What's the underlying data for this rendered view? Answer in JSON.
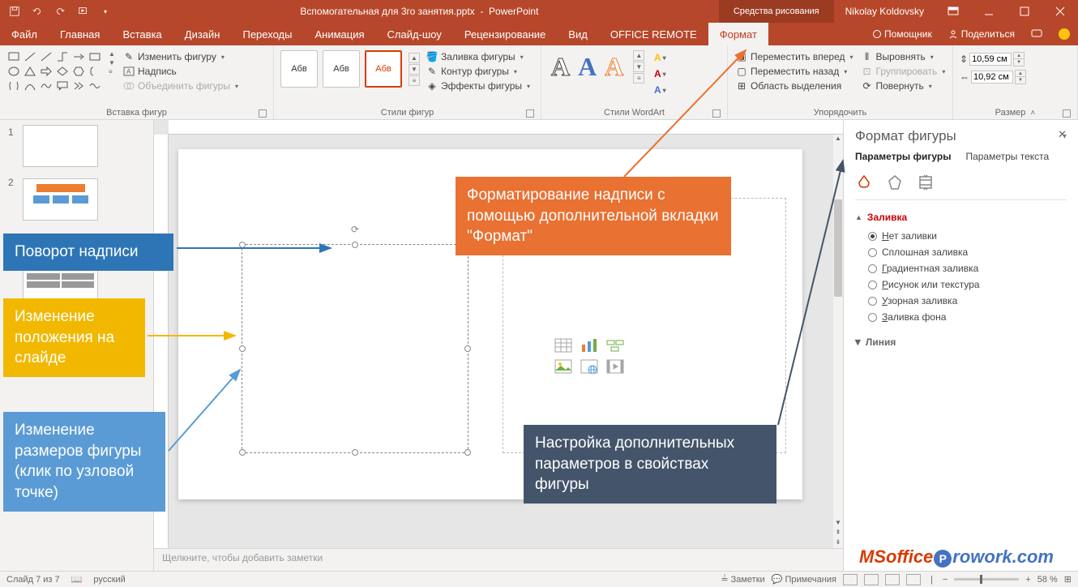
{
  "title": {
    "document": "Вспомогательная для 3го занятия.pptx",
    "app": "PowerPoint",
    "context_tab": "Средства рисования",
    "user": "Nikolay Koldovsky"
  },
  "tabs": {
    "file": "Файл",
    "list": [
      "Главная",
      "Вставка",
      "Дизайн",
      "Переходы",
      "Анимация",
      "Слайд-шоу",
      "Рецензирование",
      "Вид",
      "OFFICE REMOTE"
    ],
    "active": "Формат",
    "helper": "Помощник",
    "share": "Поделиться"
  },
  "ribbon": {
    "insert_shapes": {
      "label": "Вставка фигур",
      "change_shape": "Изменить фигуру",
      "text_box": "Надпись",
      "merge_shapes": "Объединить фигуры"
    },
    "shape_styles": {
      "label": "Стили фигур",
      "sample": "Абв",
      "fill": "Заливка фигуры",
      "outline": "Контур фигуры",
      "effects": "Эффекты фигуры"
    },
    "wordart_styles": {
      "label": "Стили WordArt",
      "sample": "А"
    },
    "arrange": {
      "label": "Упорядочить",
      "bring_forward": "Переместить вперед",
      "send_backward": "Переместить назад",
      "selection_pane": "Область выделения",
      "align": "Выровнять",
      "group": "Группировать",
      "rotate": "Повернуть"
    },
    "size": {
      "label": "Размер",
      "height": "10,59 см",
      "width": "10,92 см"
    }
  },
  "callouts": {
    "rotate": "Поворот надписи",
    "move": "Изменение положения на слайде",
    "resize": "Изменение размеров фигуры (клик по узловой точке)",
    "format_tab": "Форматирование надписи с помощью дополнительной вкладки \"Формат\"",
    "pane": "Настройка дополнительных параметров в свойствах фигуры"
  },
  "pane": {
    "title": "Формат фигуры",
    "tab_shape": "Параметры фигуры",
    "tab_text": "Параметры текста",
    "section_fill": "Заливка",
    "section_line": "Линия",
    "fill_options": {
      "none": "Нет заливки",
      "solid": "Сплошная заливка",
      "gradient": "Градиентная заливка",
      "picture": "Рисунок или текстура",
      "pattern": "Узорная заливка",
      "background": "Заливка фона"
    }
  },
  "notes_placeholder": "Щелкните, чтобы добавить заметки",
  "status": {
    "slide": "Слайд 7 из 7",
    "lang": "русский",
    "notes_btn": "Заметки",
    "comments_btn": "Примечания",
    "zoom": "58 %"
  },
  "watermark": {
    "part1": "MSoffice",
    "badge": "P",
    "part2": "rowork.com"
  }
}
